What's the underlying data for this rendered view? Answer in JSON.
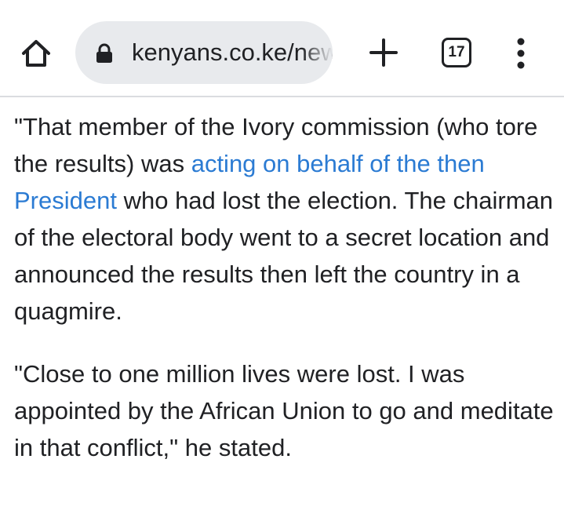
{
  "toolbar": {
    "url": "kenyans.co.ke/news",
    "tab_count": "17",
    "icons": {
      "home": "home-icon",
      "lock": "lock-icon",
      "new_tab": "plus-icon",
      "tabs": "tab-switcher-icon",
      "menu": "more-vert-icon"
    }
  },
  "article": {
    "paragraph1": {
      "before_link": "\"That member of the Ivory commission (who tore the results) was ",
      "link_text": "acting on behalf of the then President",
      "after_link": " who had lost the election. The chairman of the electoral body went to a secret location and announced the results then left the country in a quagmire."
    },
    "paragraph2": "\"Close to one million lives were lost. I was appointed by the African Union to go and meditate in that conflict,\" he stated."
  },
  "colors": {
    "link": "#2b7bd3",
    "text": "#202124",
    "omnibox_bg": "#e8eaed"
  }
}
